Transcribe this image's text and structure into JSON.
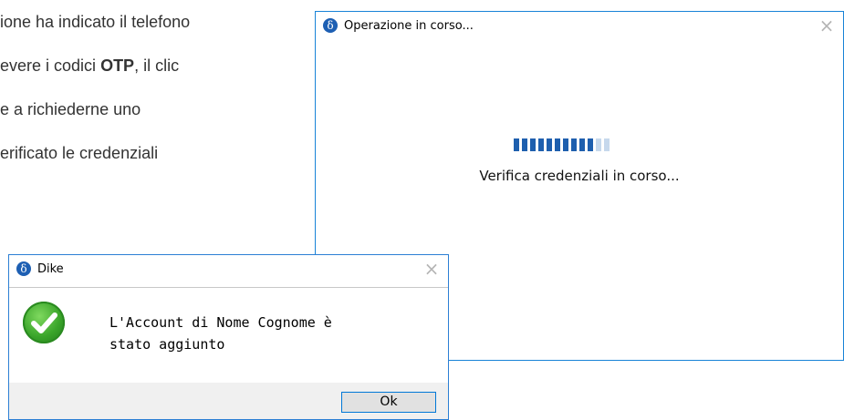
{
  "document": {
    "lines": [
      {
        "before": "ione ha indicato il telefono",
        "bold": "",
        "after": ""
      },
      {
        "before": "evere i codici ",
        "bold": "OTP",
        "after": ", il clic"
      },
      {
        "before": "e a richiederne uno",
        "bold": "",
        "after": ""
      },
      {
        "before": "erificato le credenziali",
        "bold": "",
        "after": ""
      }
    ]
  },
  "progress_window": {
    "icon": "δ",
    "title": "Operazione in corso...",
    "close": "×",
    "progress": {
      "filled_segments": 10,
      "total_segments": 12
    },
    "status": "Verifica credenziali in corso..."
  },
  "dike_dialog": {
    "icon": "δ",
    "title": "Dike",
    "close": "×",
    "message_line1": "L'Account di Nome Cognome è",
    "message_line2": "stato aggiunto",
    "ok_label": "Ok",
    "success_icon": "check-icon"
  },
  "colors": {
    "accent": "#1883d7",
    "progress_on": "#1e5fae",
    "progress_off": "#c6d8ec",
    "success": "#3aa52a"
  }
}
